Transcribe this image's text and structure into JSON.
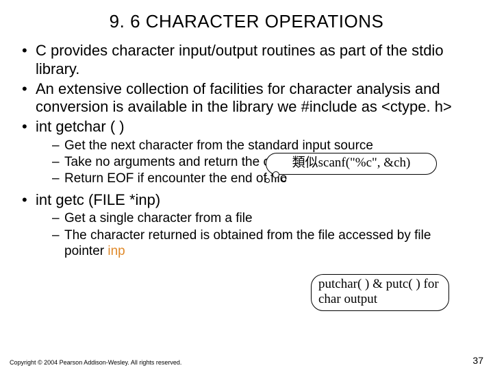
{
  "title": "9. 6 CHARACTER OPERATIONS",
  "bullets": {
    "b1": "C provides character input/output routines as part of the stdio library.",
    "b2": "An extensive collection of facilities for character analysis and conversion is available in the library we #include as <ctype. h>",
    "b3": "int getchar ( )",
    "b3_sub1": "Get the next character from the standard input source",
    "b3_sub2": "Take no arguments and return the character as its result",
    "b3_sub3": "Return EOF if encounter the end of file",
    "b4": "int getc (FILE *inp)",
    "b4_sub1": "Get a single character from a file",
    "b4_sub2_a": "The character returned is obtained from the file accessed by file pointer ",
    "b4_sub2_b": "inp"
  },
  "callout1": "類似scanf(\"%c\", &ch)",
  "callout2": "putchar( ) & putc( ) for char output",
  "copyright": "Copyright © 2004 Pearson Addison-Wesley. All rights reserved.",
  "page": "37"
}
